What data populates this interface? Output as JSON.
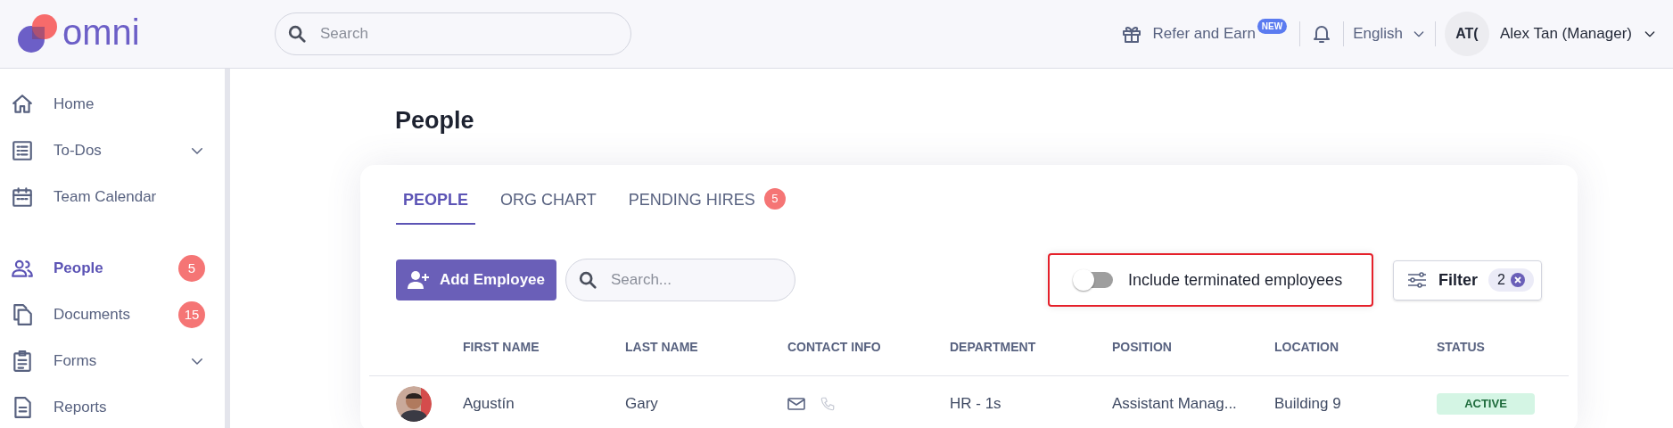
{
  "header": {
    "logo": "omni",
    "search": {
      "placeholder": "Search"
    },
    "refer": {
      "label": "Refer and Earn",
      "badge": "NEW"
    },
    "language": "English",
    "user": {
      "initials": "AT(",
      "name": "Alex Tan (Manager)"
    }
  },
  "sidebar": {
    "groups": [
      [
        {
          "label": "Home",
          "selected": false
        },
        {
          "label": "To-Dos",
          "selected": false,
          "expanded": false
        },
        {
          "label": "Team Calendar",
          "selected": false
        }
      ],
      [
        {
          "label": "People",
          "selected": true,
          "badge": "5"
        },
        {
          "label": "Documents",
          "selected": false,
          "badge": "15"
        },
        {
          "label": "Forms",
          "selected": false,
          "expanded": false
        },
        {
          "label": "Reports",
          "selected": false
        }
      ]
    ]
  },
  "page": {
    "title": "People",
    "tabs": [
      {
        "label": "PEOPLE",
        "selected": true
      },
      {
        "label": "ORG CHART",
        "selected": false
      },
      {
        "label": "PENDING HIRES",
        "selected": false,
        "badge": "5"
      }
    ],
    "add_button": "Add Employee",
    "search": {
      "placeholder": "Search..."
    },
    "terminated_toggle": {
      "label": "Include terminated employees",
      "on": false,
      "highlighted": true
    },
    "filter": {
      "label": "Filter",
      "count": "2"
    },
    "table": {
      "columns": [
        "FIRST NAME",
        "LAST NAME",
        "CONTACT INFO",
        "DEPARTMENT",
        "POSITION",
        "LOCATION",
        "STATUS"
      ],
      "rows": [
        {
          "first_name": "Agustín",
          "last_name": "Gary",
          "has_email": true,
          "has_phone": false,
          "department": "HR - 1s",
          "position": "Assistant Manag...",
          "location": "Building 9",
          "status": "ACTIVE"
        }
      ]
    }
  }
}
